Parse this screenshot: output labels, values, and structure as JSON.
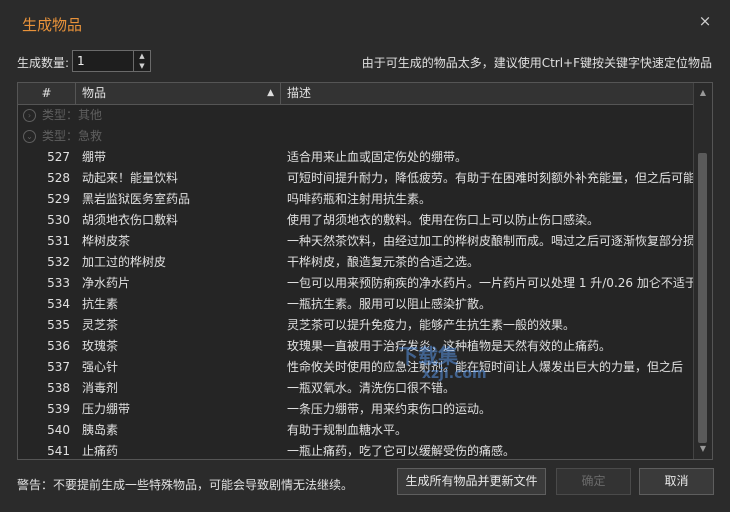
{
  "dialog": {
    "title": "生成物品",
    "close_icon": "×"
  },
  "quantity": {
    "label": "生成数量:",
    "value": "1",
    "up": "▲",
    "down": "▼"
  },
  "hint": "由于可生成的物品太多，建议使用Ctrl+F键按关键字快速定位物品",
  "table": {
    "headers": {
      "num": "#",
      "item": "物品",
      "desc": "描述",
      "sort_arrow": "▲"
    },
    "groups": [
      {
        "label": "类型：其他",
        "icon": "expand-icon"
      },
      {
        "label": "类型：急救",
        "icon": "collapse-icon"
      }
    ],
    "rows": [
      {
        "num": "527",
        "item": "绷带",
        "desc": "适合用来止血或固定伤处的绷带。"
      },
      {
        "num": "528",
        "item": "动起来！能量饮料",
        "desc": "可短时间提升耐力，降低疲劳。有助于在困难时刻额外补充能量，但之后可能"
      },
      {
        "num": "529",
        "item": "黑岩监狱医务室药品",
        "desc": "吗啡药瓶和注射用抗生素。"
      },
      {
        "num": "530",
        "item": "胡须地衣伤口敷料",
        "desc": "使用了胡须地衣的敷料。使用在伤口上可以防止伤口感染。"
      },
      {
        "num": "531",
        "item": "桦树皮茶",
        "desc": "一种天然茶饮料，由经过加工的桦树皮酿制而成。喝过之后可逐渐恢复部分损"
      },
      {
        "num": "532",
        "item": "加工过的桦树皮",
        "desc": "干桦树皮，酿造复元茶的合适之选。"
      },
      {
        "num": "533",
        "item": "净水药片",
        "desc": "一包可以用来预防痢疾的净水药片。一片药片可以处理 1 升/0.26 加仑不适于"
      },
      {
        "num": "534",
        "item": "抗生素",
        "desc": "一瓶抗生素。服用可以阻止感染扩散。"
      },
      {
        "num": "535",
        "item": "灵芝茶",
        "desc": "灵芝茶可以提升免疫力，能够产生抗生素一般的效果。"
      },
      {
        "num": "536",
        "item": "玫瑰茶",
        "desc": "玫瑰果一直被用于治疗发炎，这种植物是天然有效的止痛药。"
      },
      {
        "num": "537",
        "item": "强心针",
        "desc": "性命攸关时使用的应急注射剂。能在短时间让人爆发出巨大的力量，但之后"
      },
      {
        "num": "538",
        "item": "消毒剂",
        "desc": "一瓶双氧水。清洗伤口很不错。"
      },
      {
        "num": "539",
        "item": "压力绷带",
        "desc": "一条压力绷带，用来约束伤口的运动。"
      },
      {
        "num": "540",
        "item": "胰岛素",
        "desc": "有助于规制血糖水平。"
      },
      {
        "num": "541",
        "item": "止痛药",
        "desc": "一瓶止痛药，吃了它可以缓解受伤的痛感。"
      }
    ]
  },
  "scrollbar": {
    "up": "▲",
    "down": "▼"
  },
  "footer": {
    "warning": "警告：不要提前生成一些特殊物品，可能会导致剧情无法继续。",
    "generate_all": "生成所有物品并更新文件",
    "ok": "确定",
    "cancel": "取消"
  },
  "watermark": {
    "text": "下载集",
    "url": "xzji.com"
  },
  "colors": {
    "title": "#e8923a",
    "background": "#2b2b2b",
    "group_text": "#5f5f5f"
  }
}
